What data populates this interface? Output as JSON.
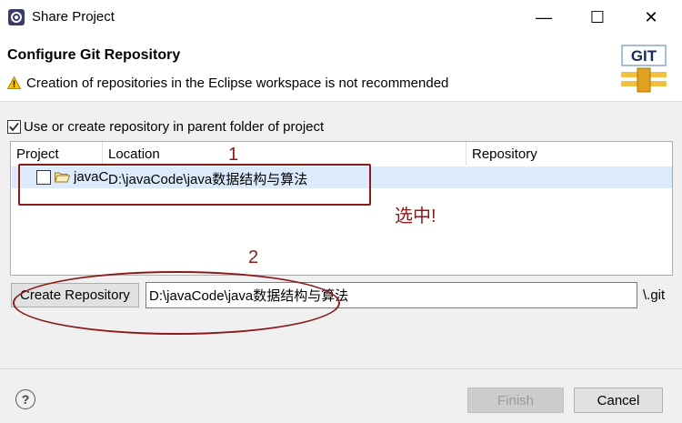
{
  "window": {
    "title": "Share Project",
    "minimize_glyph": "—",
    "maximize_glyph": "☐",
    "close_glyph": "✕"
  },
  "header": {
    "title": "Configure Git Repository",
    "warning": "Creation of repositories in the Eclipse workspace is not recommended",
    "logo_text": "GIT"
  },
  "parent_folder_option": {
    "label": "Use or create repository in parent folder of project",
    "checked": true
  },
  "table": {
    "columns": [
      "Project",
      "Location",
      "Repository"
    ],
    "rows": [
      {
        "checked": false,
        "project": "javaCode",
        "location": "D:\\javaCode\\java数据结构与算法",
        "repository": ""
      }
    ]
  },
  "annotations": {
    "label_1": "1",
    "label_2": "2",
    "note": "选中!",
    "color": "#8b1a1a"
  },
  "repository": {
    "create_button": "Create Repository",
    "path_value": "D:\\javaCode\\java数据结构与算法",
    "suffix": "\\.git"
  },
  "footer": {
    "help_glyph": "?",
    "finish_label": "Finish",
    "cancel_label": "Cancel"
  }
}
